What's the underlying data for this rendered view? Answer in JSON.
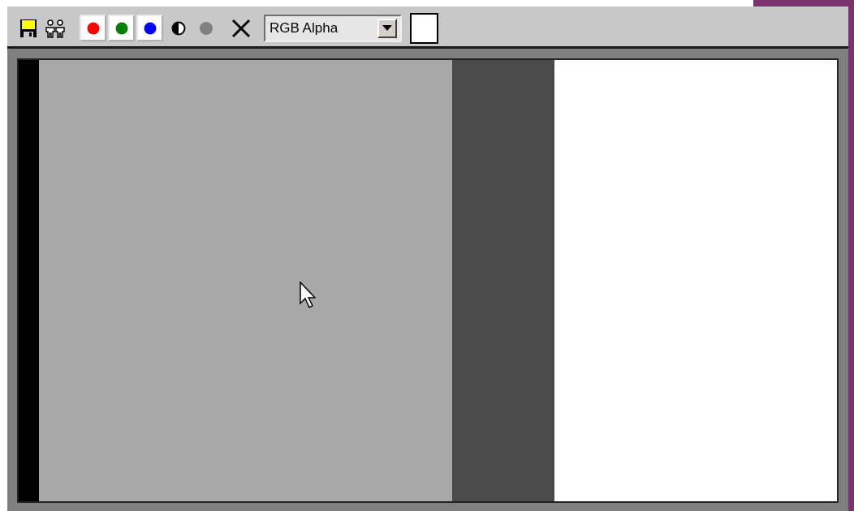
{
  "toolbar": {
    "channels": [
      {
        "color": "#ff0000",
        "on": true
      },
      {
        "color": "#008000",
        "on": true
      },
      {
        "color": "#0000ff",
        "on": true
      }
    ],
    "display_mode": {
      "value": "RGB Alpha"
    }
  }
}
